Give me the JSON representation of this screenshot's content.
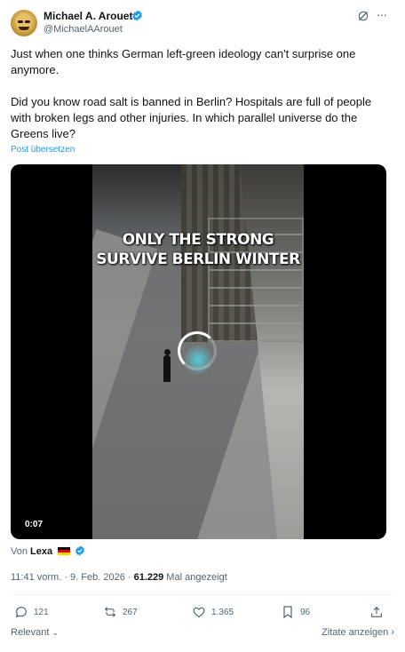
{
  "author": {
    "name": "Michael A. Arouet",
    "handle": "@MichaelAArouet"
  },
  "tweet": {
    "text": "Just when one thinks German left-green ideology can't surprise one anymore.\n\nDid you know road salt is banned in Berlin? Hospitals are full of people with broken legs and other injuries. In which parallel universe do the Greens live?",
    "translate_link": "Post übersetzen"
  },
  "video": {
    "caption": "ONLY THE STRONG\nSURVIVE BERLIN WINTER",
    "timestamp": "0:07",
    "credit_prefix": "Von",
    "credit_name": "Lexa"
  },
  "meta": {
    "time_date": "11:41 vorm. · 9. Feb. 2026 · ",
    "views": "61.229",
    "views_label": " Mal angezeigt"
  },
  "actions": {
    "replies": "121",
    "reposts": "267",
    "likes": "1.365",
    "bookmarks": "96"
  },
  "footer": {
    "sort_label": "Relevant",
    "quotes_label": "Zitate anzeigen"
  },
  "colors": {
    "accent": "#1d9bf0",
    "text": "#0f1419",
    "secondary": "#536471"
  }
}
